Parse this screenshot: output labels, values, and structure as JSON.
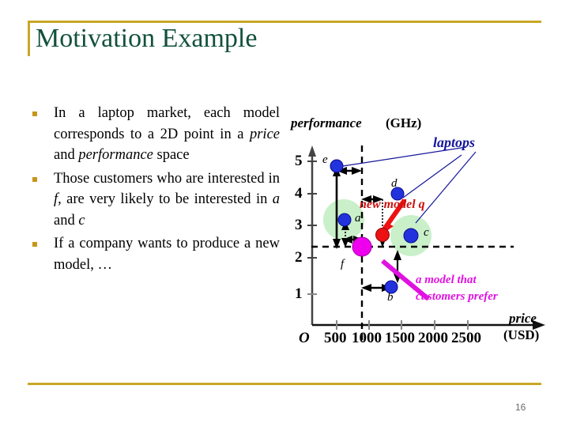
{
  "slide": {
    "title": "Motivation Example",
    "number": "16",
    "accent_gold": "#c8a727",
    "title_green": "#13513c"
  },
  "bullets": [
    {
      "marker": "square",
      "segments": [
        {
          "text": "In a laptop market, each model corresponds to a 2D point in a ",
          "style": "normal"
        },
        {
          "text": "price",
          "style": "italic"
        },
        {
          "text": " and ",
          "style": "normal"
        },
        {
          "text": "performance",
          "style": "italic"
        },
        {
          "text": " space",
          "style": "normal"
        }
      ],
      "plain": "In a laptop market, each model corresponds to a 2D point in a price and performance space"
    },
    {
      "marker": "square",
      "segments": [
        {
          "text": "Those customers who are interested in ",
          "style": "normal"
        },
        {
          "text": "f",
          "style": "italic"
        },
        {
          "text": ", are very likely to be interested in ",
          "style": "normal"
        },
        {
          "text": "a",
          "style": "italic"
        },
        {
          "text": " and ",
          "style": "normal"
        },
        {
          "text": "c",
          "style": "italic"
        }
      ],
      "plain": "Those customers who are interested in f, are very likely to be interested in a and c"
    },
    {
      "marker": "square",
      "segments": [
        {
          "text": "If a company wants to produce a new model, …",
          "style": "normal"
        }
      ],
      "plain": "If a company wants to produce a new model, …"
    }
  ],
  "chart_data": {
    "type": "scatter",
    "title": "",
    "xlabel_italic": "price",
    "xlabel_unit": "(USD)",
    "ylabel_italic": "performance",
    "ylabel_unit": "(GHz)",
    "origin_label": "O",
    "xticks": [
      "500",
      "1000",
      "1500",
      "2000",
      "2500"
    ],
    "xtick_values": [
      500,
      1000,
      1500,
      2000,
      2500
    ],
    "yticks": [
      "1",
      "2",
      "3",
      "4",
      "5"
    ],
    "ytick_values": [
      1,
      2,
      3,
      4,
      5
    ],
    "xlim": [
      0,
      3000
    ],
    "ylim": [
      0,
      5.6
    ],
    "grid": false,
    "points": [
      {
        "name": "e",
        "x": 380,
        "y": 4.8,
        "color": "#2233dd",
        "kind": "laptop",
        "highlight": false
      },
      {
        "name": "d",
        "x": 1280,
        "y": 4.0,
        "color": "#2233dd",
        "kind": "laptop",
        "highlight": false
      },
      {
        "name": "a",
        "x": 490,
        "y": 3.15,
        "color": "#2233dd",
        "kind": "laptop",
        "highlight": true
      },
      {
        "name": "c",
        "x": 1560,
        "y": 2.7,
        "color": "#2233dd",
        "kind": "laptop",
        "highlight": true
      },
      {
        "name": "b",
        "x": 1230,
        "y": 1.2,
        "color": "#2233dd",
        "kind": "laptop",
        "highlight": false
      },
      {
        "name": "q",
        "x": 1080,
        "y": 2.75,
        "color": "#ee1111",
        "kind": "new-model",
        "highlight": false
      },
      {
        "name": "f",
        "x": 790,
        "y": 2.35,
        "color": "#ee00ee",
        "kind": "customer-preference",
        "highlight": false
      }
    ],
    "reference_lines": [
      {
        "orientation": "vertical",
        "at_x": 790,
        "style": "dashed"
      },
      {
        "orientation": "horizontal",
        "at_y": 2.35,
        "style": "dashed"
      }
    ],
    "annotations": [
      {
        "id": "laptops",
        "text": "laptops",
        "color": "#16179c",
        "points_to": [
          "e",
          "d",
          "c"
        ]
      },
      {
        "id": "new-model",
        "text": "new model q",
        "color": "#cc1111",
        "points_to": [
          "q"
        ]
      },
      {
        "id": "prefer",
        "text_line1": "a model that",
        "text_line2": "customers prefer",
        "color": "#e012e0",
        "points_to": [
          "f"
        ]
      }
    ],
    "distance_arrows": [
      {
        "from": "f",
        "to": "e",
        "axis": "both"
      },
      {
        "from": "f",
        "to": "a",
        "axis": "both"
      },
      {
        "from": "f",
        "to": "d",
        "axis": "both"
      },
      {
        "from": "f",
        "to": "c",
        "axis": "both"
      },
      {
        "from": "f",
        "to": "b",
        "axis": "both"
      }
    ]
  }
}
